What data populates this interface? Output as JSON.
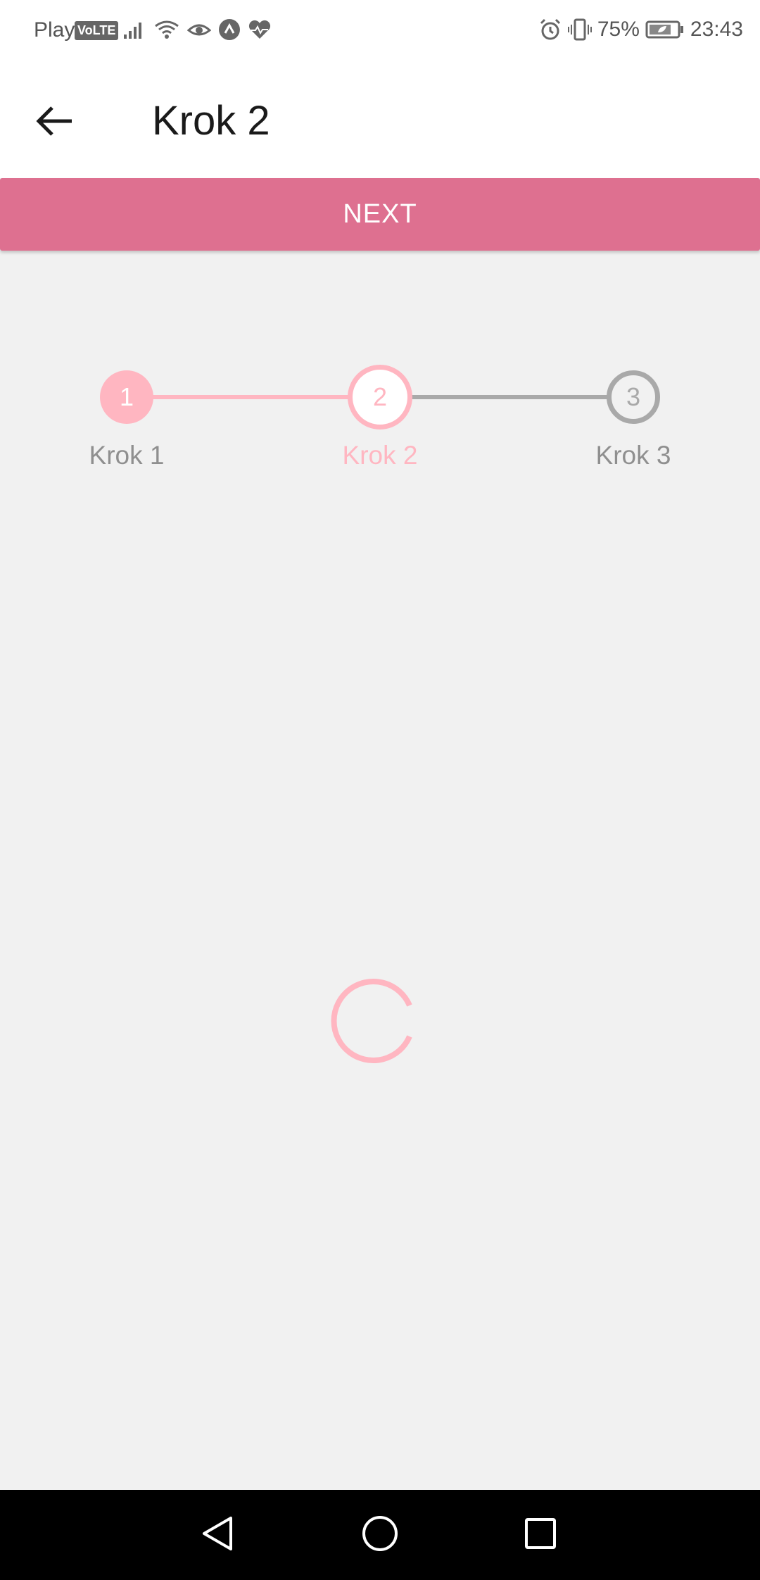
{
  "status_bar": {
    "carrier": "Play",
    "volte": "VoLTE",
    "battery": "75%",
    "time": "23:43"
  },
  "toolbar": {
    "title": "Krok 2"
  },
  "next_button": {
    "label": "NEXT"
  },
  "stepper": {
    "current_step": 2,
    "steps": [
      {
        "number": "1",
        "label": "Krok 1",
        "state": "completed"
      },
      {
        "number": "2",
        "label": "Krok 2",
        "state": "active"
      },
      {
        "number": "3",
        "label": "Krok 3",
        "state": "inactive"
      }
    ]
  },
  "colors": {
    "accent": "#de7090",
    "step_active": "#ffb6c1",
    "step_inactive": "#a9a9a9",
    "background": "#f1f1f1"
  },
  "icons": [
    "back-arrow-icon",
    "signal-icon",
    "wifi-icon",
    "eye-icon",
    "app-icon",
    "heart-rate-icon",
    "alarm-icon",
    "vibrate-icon",
    "battery-icon",
    "loading-spinner-icon",
    "nav-back-icon",
    "nav-home-icon",
    "nav-recents-icon"
  ]
}
